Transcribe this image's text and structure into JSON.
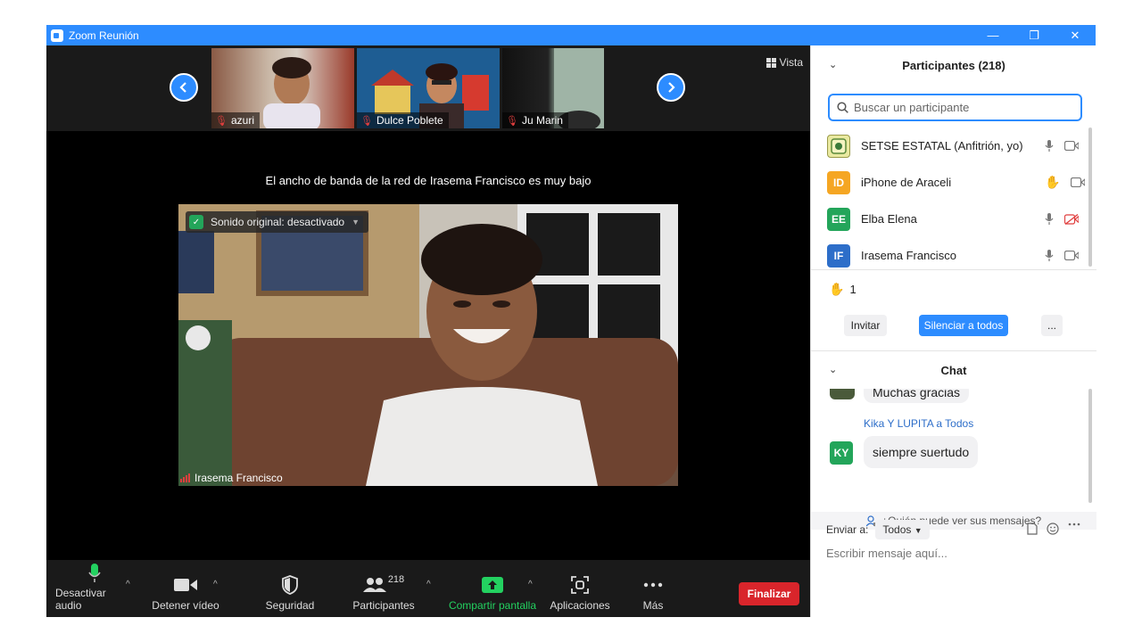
{
  "window": {
    "title": "Zoom Reunión",
    "minimize": "—",
    "restore": "❐",
    "close": "✕"
  },
  "gallery": {
    "view_label": "Vista",
    "thumbnails": [
      {
        "name": "azuri"
      },
      {
        "name": "Dulce Poblete"
      },
      {
        "name": "Ju Marin"
      }
    ]
  },
  "notice": "El ancho de banda de la red de Irasema Francisco es muy bajo",
  "main_video": {
    "sound_label": "Sonido original: desactivado",
    "speaker_name": "Irasema Francisco"
  },
  "toolbar": {
    "audio_label": "Desactivar audio",
    "video_label": "Detener vídeo",
    "security_label": "Seguridad",
    "participants_label": "Participantes",
    "participants_count": "218",
    "share_label": "Compartir pantalla",
    "apps_label": "Aplicaciones",
    "more_label": "Más",
    "end_label": "Finalizar"
  },
  "participants_panel": {
    "title": "Participantes (218)",
    "search_placeholder": "Buscar un participante",
    "items": [
      {
        "name": "SETSE ESTATAL (Anfitrión, yo)",
        "initials": "",
        "color": "#e9e9a0"
      },
      {
        "name": "iPhone de Araceli",
        "initials": "ID",
        "color": "#f5a623"
      },
      {
        "name": "Elba Elena",
        "initials": "EE",
        "color": "#23a55a"
      },
      {
        "name": "Irasema Francisco",
        "initials": "IF",
        "color": "#2d6ec9"
      }
    ],
    "raised_hands": "1",
    "invite_label": "Invitar",
    "mute_all_label": "Silenciar a todos",
    "more_label": "..."
  },
  "chat": {
    "title": "Chat",
    "partial_message": "Muchas gracias",
    "sender_line": "Kika Y LUPITA a Todos",
    "sender_initials": "KY",
    "message": "siempre suertudo",
    "privacy_notice": "¿Quién puede ver sus mensajes?",
    "send_to_label": "Enviar a:",
    "recipient": "Todos",
    "input_placeholder": "Escribir mensaje aquí..."
  },
  "colors": {
    "accent": "#2d8cff",
    "end_button": "#d9252b",
    "share_green": "#23d160"
  }
}
